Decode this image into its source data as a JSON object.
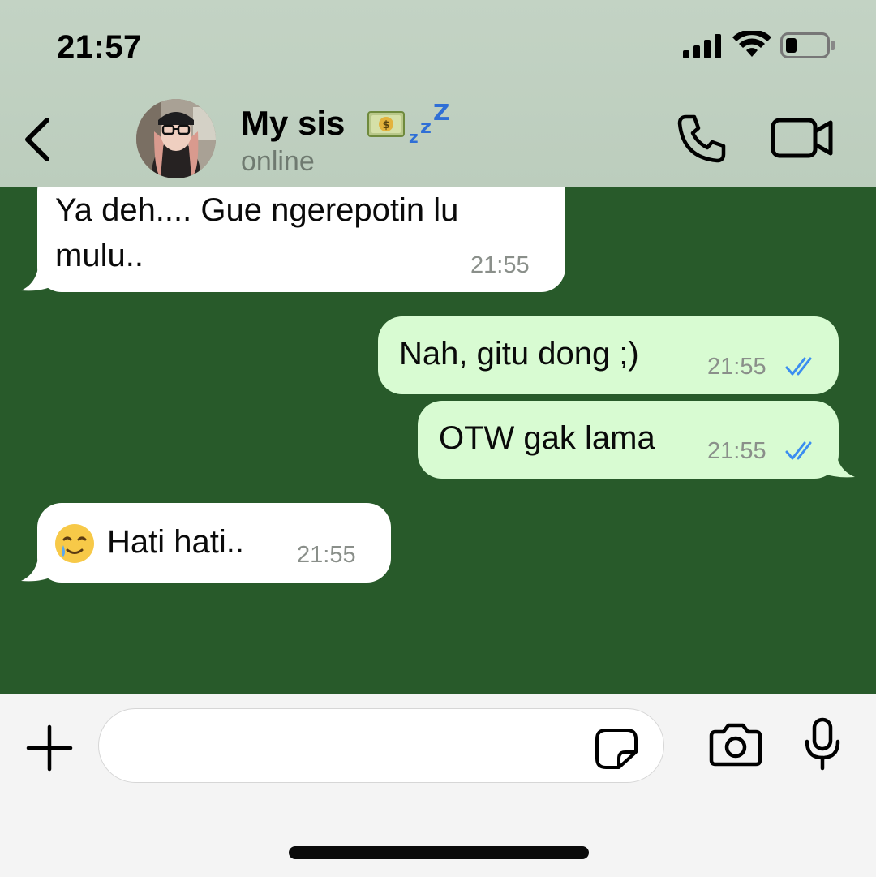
{
  "status_bar": {
    "time": "21:57"
  },
  "header": {
    "contact_name": "My sis",
    "contact_status": "online"
  },
  "messages": [
    {
      "direction": "incoming",
      "text_line1": "Ya deh.... Gue ngerepotin lu",
      "text_line2": "mulu..",
      "time": "21:55"
    },
    {
      "direction": "outgoing",
      "text": "Nah, gitu dong ;)",
      "time": "21:55",
      "status": "read"
    },
    {
      "direction": "outgoing",
      "text": "OTW gak lama",
      "time": "21:55",
      "status": "read"
    },
    {
      "direction": "incoming",
      "emoji": "smiling-face-with-tear",
      "text": "Hati hati..",
      "time": "21:55"
    }
  ],
  "composer": {
    "placeholder": ""
  },
  "icons": {
    "back": "chevron-left-icon",
    "call": "phone-icon",
    "video": "video-camera-icon",
    "plus": "plus-icon",
    "sticker": "sticker-icon",
    "camera": "camera-icon",
    "mic": "microphone-icon",
    "name_emoji": "money-bill-sleeping-zzz-emoji"
  },
  "colors": {
    "chat_background": "#285a2a",
    "header_background": "#c3d3c4",
    "outgoing_bubble": "#d8fbd2",
    "incoming_bubble": "#ffffff",
    "read_ticks": "#3b8df0"
  }
}
